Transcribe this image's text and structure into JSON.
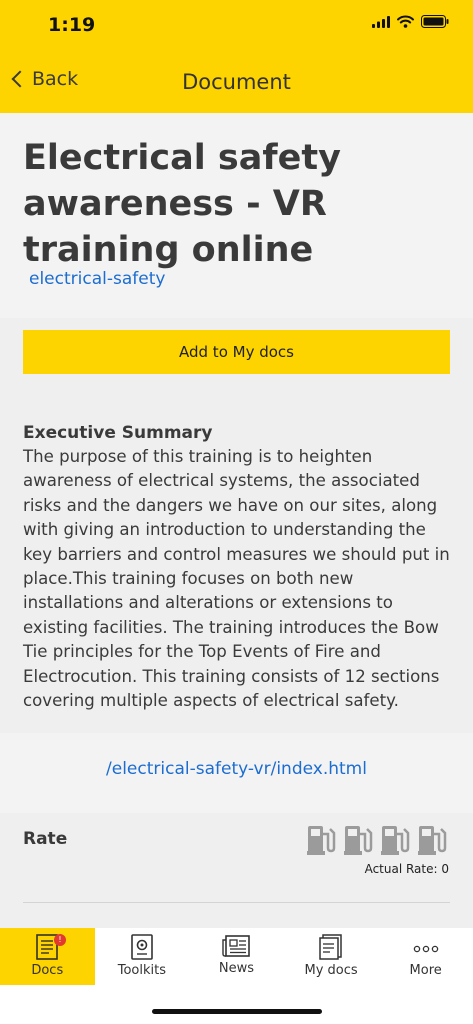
{
  "status_bar": {
    "time": "1:19"
  },
  "nav": {
    "back_label": "Back",
    "title": "Document"
  },
  "document": {
    "title": "Electrical safety awareness - VR training online",
    "tag": "electrical-safety",
    "add_button_label": "Add to My docs",
    "summary_heading": "Executive Summary",
    "summary_text": "The purpose of this training is to heighten awareness of electrical systems, the associated risks and the dangers we have on our sites, along with giving an introduction to understanding the key barriers and control measures we should put in place.This training focuses on both new installations and alterations or extensions to existing facilities. The training introduces the Bow Tie principles for the Top Events of Fire and Electrocution. This training consists of 12 sections covering multiple aspects of electrical safety.",
    "url": "/electrical-safety-vr/index.html"
  },
  "rating": {
    "label": "Rate",
    "icon": "fuel-pump-icon",
    "max": 4,
    "value": 0,
    "actual_rate_text": "Actual Rate: 0"
  },
  "tabs": [
    {
      "label": "Docs",
      "icon": "document-icon",
      "active": true,
      "badge": "!"
    },
    {
      "label": "Toolkits",
      "icon": "toolkit-icon",
      "active": false
    },
    {
      "label": "News",
      "icon": "newspaper-icon",
      "active": false
    },
    {
      "label": "My docs",
      "icon": "my-docs-icon",
      "active": false
    },
    {
      "label": "More",
      "icon": "more-dots-icon",
      "active": false
    }
  ],
  "colors": {
    "accent": "#fdd300",
    "link": "#1c6dd0",
    "text": "#3a3a3a",
    "badge": "#e23b2e"
  }
}
